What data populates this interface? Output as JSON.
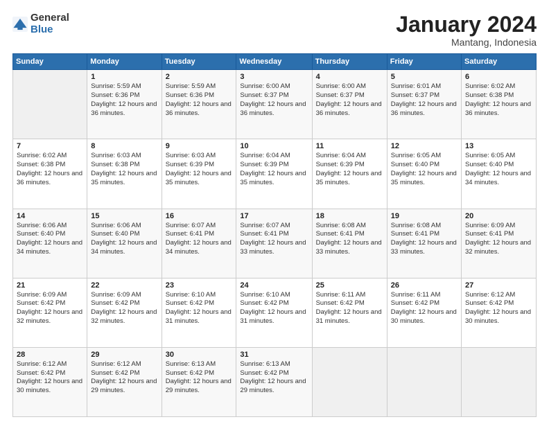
{
  "logo": {
    "general": "General",
    "blue": "Blue"
  },
  "header": {
    "month": "January 2024",
    "location": "Mantang, Indonesia"
  },
  "weekdays": [
    "Sunday",
    "Monday",
    "Tuesday",
    "Wednesday",
    "Thursday",
    "Friday",
    "Saturday"
  ],
  "weeks": [
    [
      {
        "day": "",
        "sunrise": "",
        "sunset": "",
        "daylight": ""
      },
      {
        "day": "1",
        "sunrise": "Sunrise: 5:59 AM",
        "sunset": "Sunset: 6:36 PM",
        "daylight": "Daylight: 12 hours and 36 minutes."
      },
      {
        "day": "2",
        "sunrise": "Sunrise: 5:59 AM",
        "sunset": "Sunset: 6:36 PM",
        "daylight": "Daylight: 12 hours and 36 minutes."
      },
      {
        "day": "3",
        "sunrise": "Sunrise: 6:00 AM",
        "sunset": "Sunset: 6:37 PM",
        "daylight": "Daylight: 12 hours and 36 minutes."
      },
      {
        "day": "4",
        "sunrise": "Sunrise: 6:00 AM",
        "sunset": "Sunset: 6:37 PM",
        "daylight": "Daylight: 12 hours and 36 minutes."
      },
      {
        "day": "5",
        "sunrise": "Sunrise: 6:01 AM",
        "sunset": "Sunset: 6:37 PM",
        "daylight": "Daylight: 12 hours and 36 minutes."
      },
      {
        "day": "6",
        "sunrise": "Sunrise: 6:02 AM",
        "sunset": "Sunset: 6:38 PM",
        "daylight": "Daylight: 12 hours and 36 minutes."
      }
    ],
    [
      {
        "day": "7",
        "sunrise": "Sunrise: 6:02 AM",
        "sunset": "Sunset: 6:38 PM",
        "daylight": "Daylight: 12 hours and 36 minutes."
      },
      {
        "day": "8",
        "sunrise": "Sunrise: 6:03 AM",
        "sunset": "Sunset: 6:38 PM",
        "daylight": "Daylight: 12 hours and 35 minutes."
      },
      {
        "day": "9",
        "sunrise": "Sunrise: 6:03 AM",
        "sunset": "Sunset: 6:39 PM",
        "daylight": "Daylight: 12 hours and 35 minutes."
      },
      {
        "day": "10",
        "sunrise": "Sunrise: 6:04 AM",
        "sunset": "Sunset: 6:39 PM",
        "daylight": "Daylight: 12 hours and 35 minutes."
      },
      {
        "day": "11",
        "sunrise": "Sunrise: 6:04 AM",
        "sunset": "Sunset: 6:39 PM",
        "daylight": "Daylight: 12 hours and 35 minutes."
      },
      {
        "day": "12",
        "sunrise": "Sunrise: 6:05 AM",
        "sunset": "Sunset: 6:40 PM",
        "daylight": "Daylight: 12 hours and 35 minutes."
      },
      {
        "day": "13",
        "sunrise": "Sunrise: 6:05 AM",
        "sunset": "Sunset: 6:40 PM",
        "daylight": "Daylight: 12 hours and 34 minutes."
      }
    ],
    [
      {
        "day": "14",
        "sunrise": "Sunrise: 6:06 AM",
        "sunset": "Sunset: 6:40 PM",
        "daylight": "Daylight: 12 hours and 34 minutes."
      },
      {
        "day": "15",
        "sunrise": "Sunrise: 6:06 AM",
        "sunset": "Sunset: 6:40 PM",
        "daylight": "Daylight: 12 hours and 34 minutes."
      },
      {
        "day": "16",
        "sunrise": "Sunrise: 6:07 AM",
        "sunset": "Sunset: 6:41 PM",
        "daylight": "Daylight: 12 hours and 34 minutes."
      },
      {
        "day": "17",
        "sunrise": "Sunrise: 6:07 AM",
        "sunset": "Sunset: 6:41 PM",
        "daylight": "Daylight: 12 hours and 33 minutes."
      },
      {
        "day": "18",
        "sunrise": "Sunrise: 6:08 AM",
        "sunset": "Sunset: 6:41 PM",
        "daylight": "Daylight: 12 hours and 33 minutes."
      },
      {
        "day": "19",
        "sunrise": "Sunrise: 6:08 AM",
        "sunset": "Sunset: 6:41 PM",
        "daylight": "Daylight: 12 hours and 33 minutes."
      },
      {
        "day": "20",
        "sunrise": "Sunrise: 6:09 AM",
        "sunset": "Sunset: 6:41 PM",
        "daylight": "Daylight: 12 hours and 32 minutes."
      }
    ],
    [
      {
        "day": "21",
        "sunrise": "Sunrise: 6:09 AM",
        "sunset": "Sunset: 6:42 PM",
        "daylight": "Daylight: 12 hours and 32 minutes."
      },
      {
        "day": "22",
        "sunrise": "Sunrise: 6:09 AM",
        "sunset": "Sunset: 6:42 PM",
        "daylight": "Daylight: 12 hours and 32 minutes."
      },
      {
        "day": "23",
        "sunrise": "Sunrise: 6:10 AM",
        "sunset": "Sunset: 6:42 PM",
        "daylight": "Daylight: 12 hours and 31 minutes."
      },
      {
        "day": "24",
        "sunrise": "Sunrise: 6:10 AM",
        "sunset": "Sunset: 6:42 PM",
        "daylight": "Daylight: 12 hours and 31 minutes."
      },
      {
        "day": "25",
        "sunrise": "Sunrise: 6:11 AM",
        "sunset": "Sunset: 6:42 PM",
        "daylight": "Daylight: 12 hours and 31 minutes."
      },
      {
        "day": "26",
        "sunrise": "Sunrise: 6:11 AM",
        "sunset": "Sunset: 6:42 PM",
        "daylight": "Daylight: 12 hours and 30 minutes."
      },
      {
        "day": "27",
        "sunrise": "Sunrise: 6:12 AM",
        "sunset": "Sunset: 6:42 PM",
        "daylight": "Daylight: 12 hours and 30 minutes."
      }
    ],
    [
      {
        "day": "28",
        "sunrise": "Sunrise: 6:12 AM",
        "sunset": "Sunset: 6:42 PM",
        "daylight": "Daylight: 12 hours and 30 minutes."
      },
      {
        "day": "29",
        "sunrise": "Sunrise: 6:12 AM",
        "sunset": "Sunset: 6:42 PM",
        "daylight": "Daylight: 12 hours and 29 minutes."
      },
      {
        "day": "30",
        "sunrise": "Sunrise: 6:13 AM",
        "sunset": "Sunset: 6:42 PM",
        "daylight": "Daylight: 12 hours and 29 minutes."
      },
      {
        "day": "31",
        "sunrise": "Sunrise: 6:13 AM",
        "sunset": "Sunset: 6:42 PM",
        "daylight": "Daylight: 12 hours and 29 minutes."
      },
      {
        "day": "",
        "sunrise": "",
        "sunset": "",
        "daylight": ""
      },
      {
        "day": "",
        "sunrise": "",
        "sunset": "",
        "daylight": ""
      },
      {
        "day": "",
        "sunrise": "",
        "sunset": "",
        "daylight": ""
      }
    ]
  ]
}
